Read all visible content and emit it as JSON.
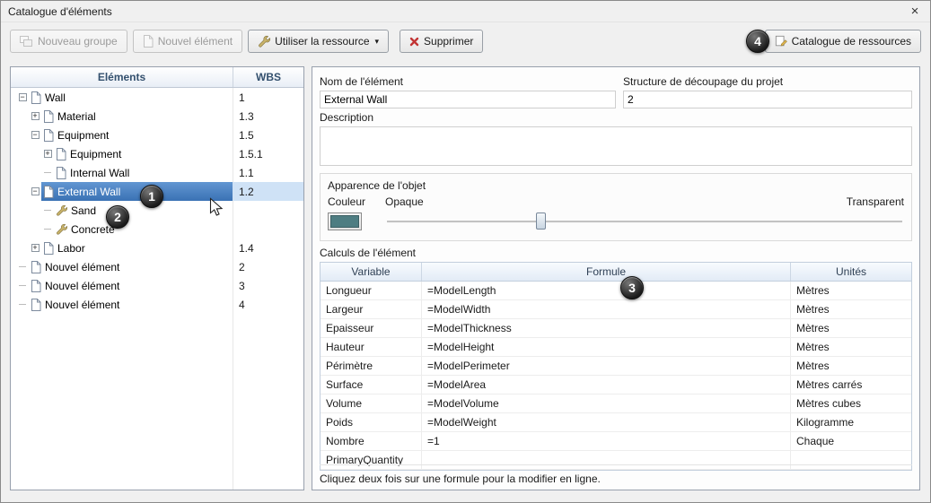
{
  "window": {
    "title": "Catalogue d'éléments",
    "close_icon": "×"
  },
  "toolbar": {
    "new_group_label": "Nouveau groupe",
    "new_element_label": "Nouvel élément",
    "use_resource_label": "Utiliser la ressource",
    "use_resource_caret": "▾",
    "delete_label": "Supprimer",
    "resource_catalog_label": "Catalogue de ressources"
  },
  "tree": {
    "header_elements": "Eléments",
    "header_wbs": "WBS",
    "items": [
      {
        "label": "Wall",
        "wbs": "1",
        "level": 0,
        "exp": "minus",
        "icon": "doc",
        "selected": false
      },
      {
        "label": "Material",
        "wbs": "1.3",
        "level": 1,
        "exp": "plus",
        "icon": "doc",
        "selected": false
      },
      {
        "label": "Equipment",
        "wbs": "1.5",
        "level": 1,
        "exp": "minus",
        "icon": "doc",
        "selected": false
      },
      {
        "label": "Equipment",
        "wbs": "1.5.1",
        "level": 2,
        "exp": "plus",
        "icon": "doc",
        "selected": false
      },
      {
        "label": "Internal Wall",
        "wbs": "1.1",
        "level": 2,
        "exp": "none",
        "icon": "doc",
        "selected": false
      },
      {
        "label": "External Wall",
        "wbs": "1.2",
        "level": 1,
        "exp": "minus",
        "icon": "doc",
        "selected": true
      },
      {
        "label": "Sand",
        "wbs": "",
        "level": 2,
        "exp": "none",
        "icon": "wrench",
        "selected": false
      },
      {
        "label": "Concrete",
        "wbs": "",
        "level": 2,
        "exp": "none",
        "icon": "wrench",
        "selected": false
      },
      {
        "label": "Labor",
        "wbs": "1.4",
        "level": 1,
        "exp": "plus",
        "icon": "doc",
        "selected": false
      },
      {
        "label": "Nouvel élément",
        "wbs": "2",
        "level": 0,
        "exp": "none",
        "icon": "doc",
        "selected": false
      },
      {
        "label": "Nouvel élément",
        "wbs": "3",
        "level": 0,
        "exp": "none",
        "icon": "doc",
        "selected": false
      },
      {
        "label": "Nouvel élément",
        "wbs": "4",
        "level": 0,
        "exp": "none",
        "icon": "doc",
        "selected": false
      }
    ]
  },
  "form": {
    "name_label": "Nom de l'élément",
    "name_value": "External Wall",
    "wbs_label": "Structure de découpage du projet",
    "wbs_value": "2",
    "description_label": "Description",
    "description_value": "",
    "appearance": {
      "title": "Apparence de l'objet",
      "color_label": "Couleur",
      "opaque_label": "Opaque",
      "transparent_label": "Transparent",
      "swatch_color": "#4e7d82",
      "slider_percent": 30
    },
    "calc_label": "Calculs de l'élément",
    "table": {
      "headers": [
        "Variable",
        "Formule",
        "Unités"
      ],
      "rows": [
        [
          "Longueur",
          "=ModelLength",
          "Mètres"
        ],
        [
          "Largeur",
          "=ModelWidth",
          "Mètres"
        ],
        [
          "Epaisseur",
          "=ModelThickness",
          "Mètres"
        ],
        [
          "Hauteur",
          "=ModelHeight",
          "Mètres"
        ],
        [
          "Périmètre",
          "=ModelPerimeter",
          "Mètres"
        ],
        [
          "Surface",
          "=ModelArea",
          "Mètres carrés"
        ],
        [
          "Volume",
          "=ModelVolume",
          "Mètres cubes"
        ],
        [
          "Poids",
          "=ModelWeight",
          "Kilogramme"
        ],
        [
          "Nombre",
          "=1",
          "Chaque"
        ],
        [
          "PrimaryQuantity",
          "",
          ""
        ]
      ]
    },
    "hint": "Cliquez deux fois sur une formule pour la modifier en ligne."
  },
  "annotations": [
    {
      "number": "1"
    },
    {
      "number": "2"
    },
    {
      "number": "3"
    },
    {
      "number": "4"
    }
  ]
}
